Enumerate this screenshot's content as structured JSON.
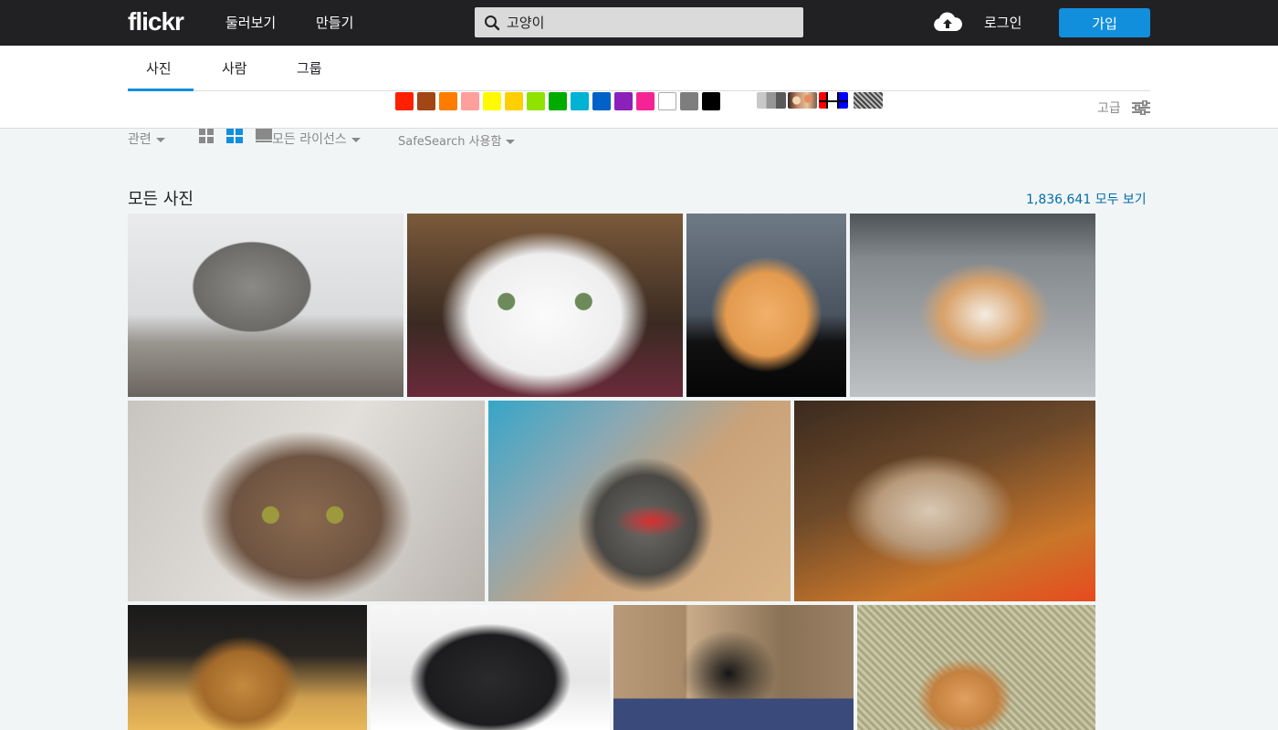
{
  "header": {
    "logo": "flickr",
    "nav": [
      "둘러보기",
      "만들기"
    ],
    "search_value": "고양이",
    "login": "로그인",
    "signup": "가입"
  },
  "tabs": [
    "사진",
    "사람",
    "그룹"
  ],
  "colors": [
    "#ff2000",
    "#a24615",
    "#ff7c00",
    "#ff9f9c",
    "#fffa00",
    "#ffcf00",
    "#90e200",
    "#00ab00",
    "#00b2d4",
    "#0062c6",
    "#8c20ba",
    "#f52394",
    "#ffffff",
    "#7e7e7e",
    "#000000"
  ],
  "advanced": "고급",
  "filters": {
    "relevance": "관련",
    "license": "모든 라이선스",
    "safesearch": "SafeSearch 사용함"
  },
  "section": {
    "title": "모든 사진",
    "view_all": "1,836,641 모두 보기"
  }
}
